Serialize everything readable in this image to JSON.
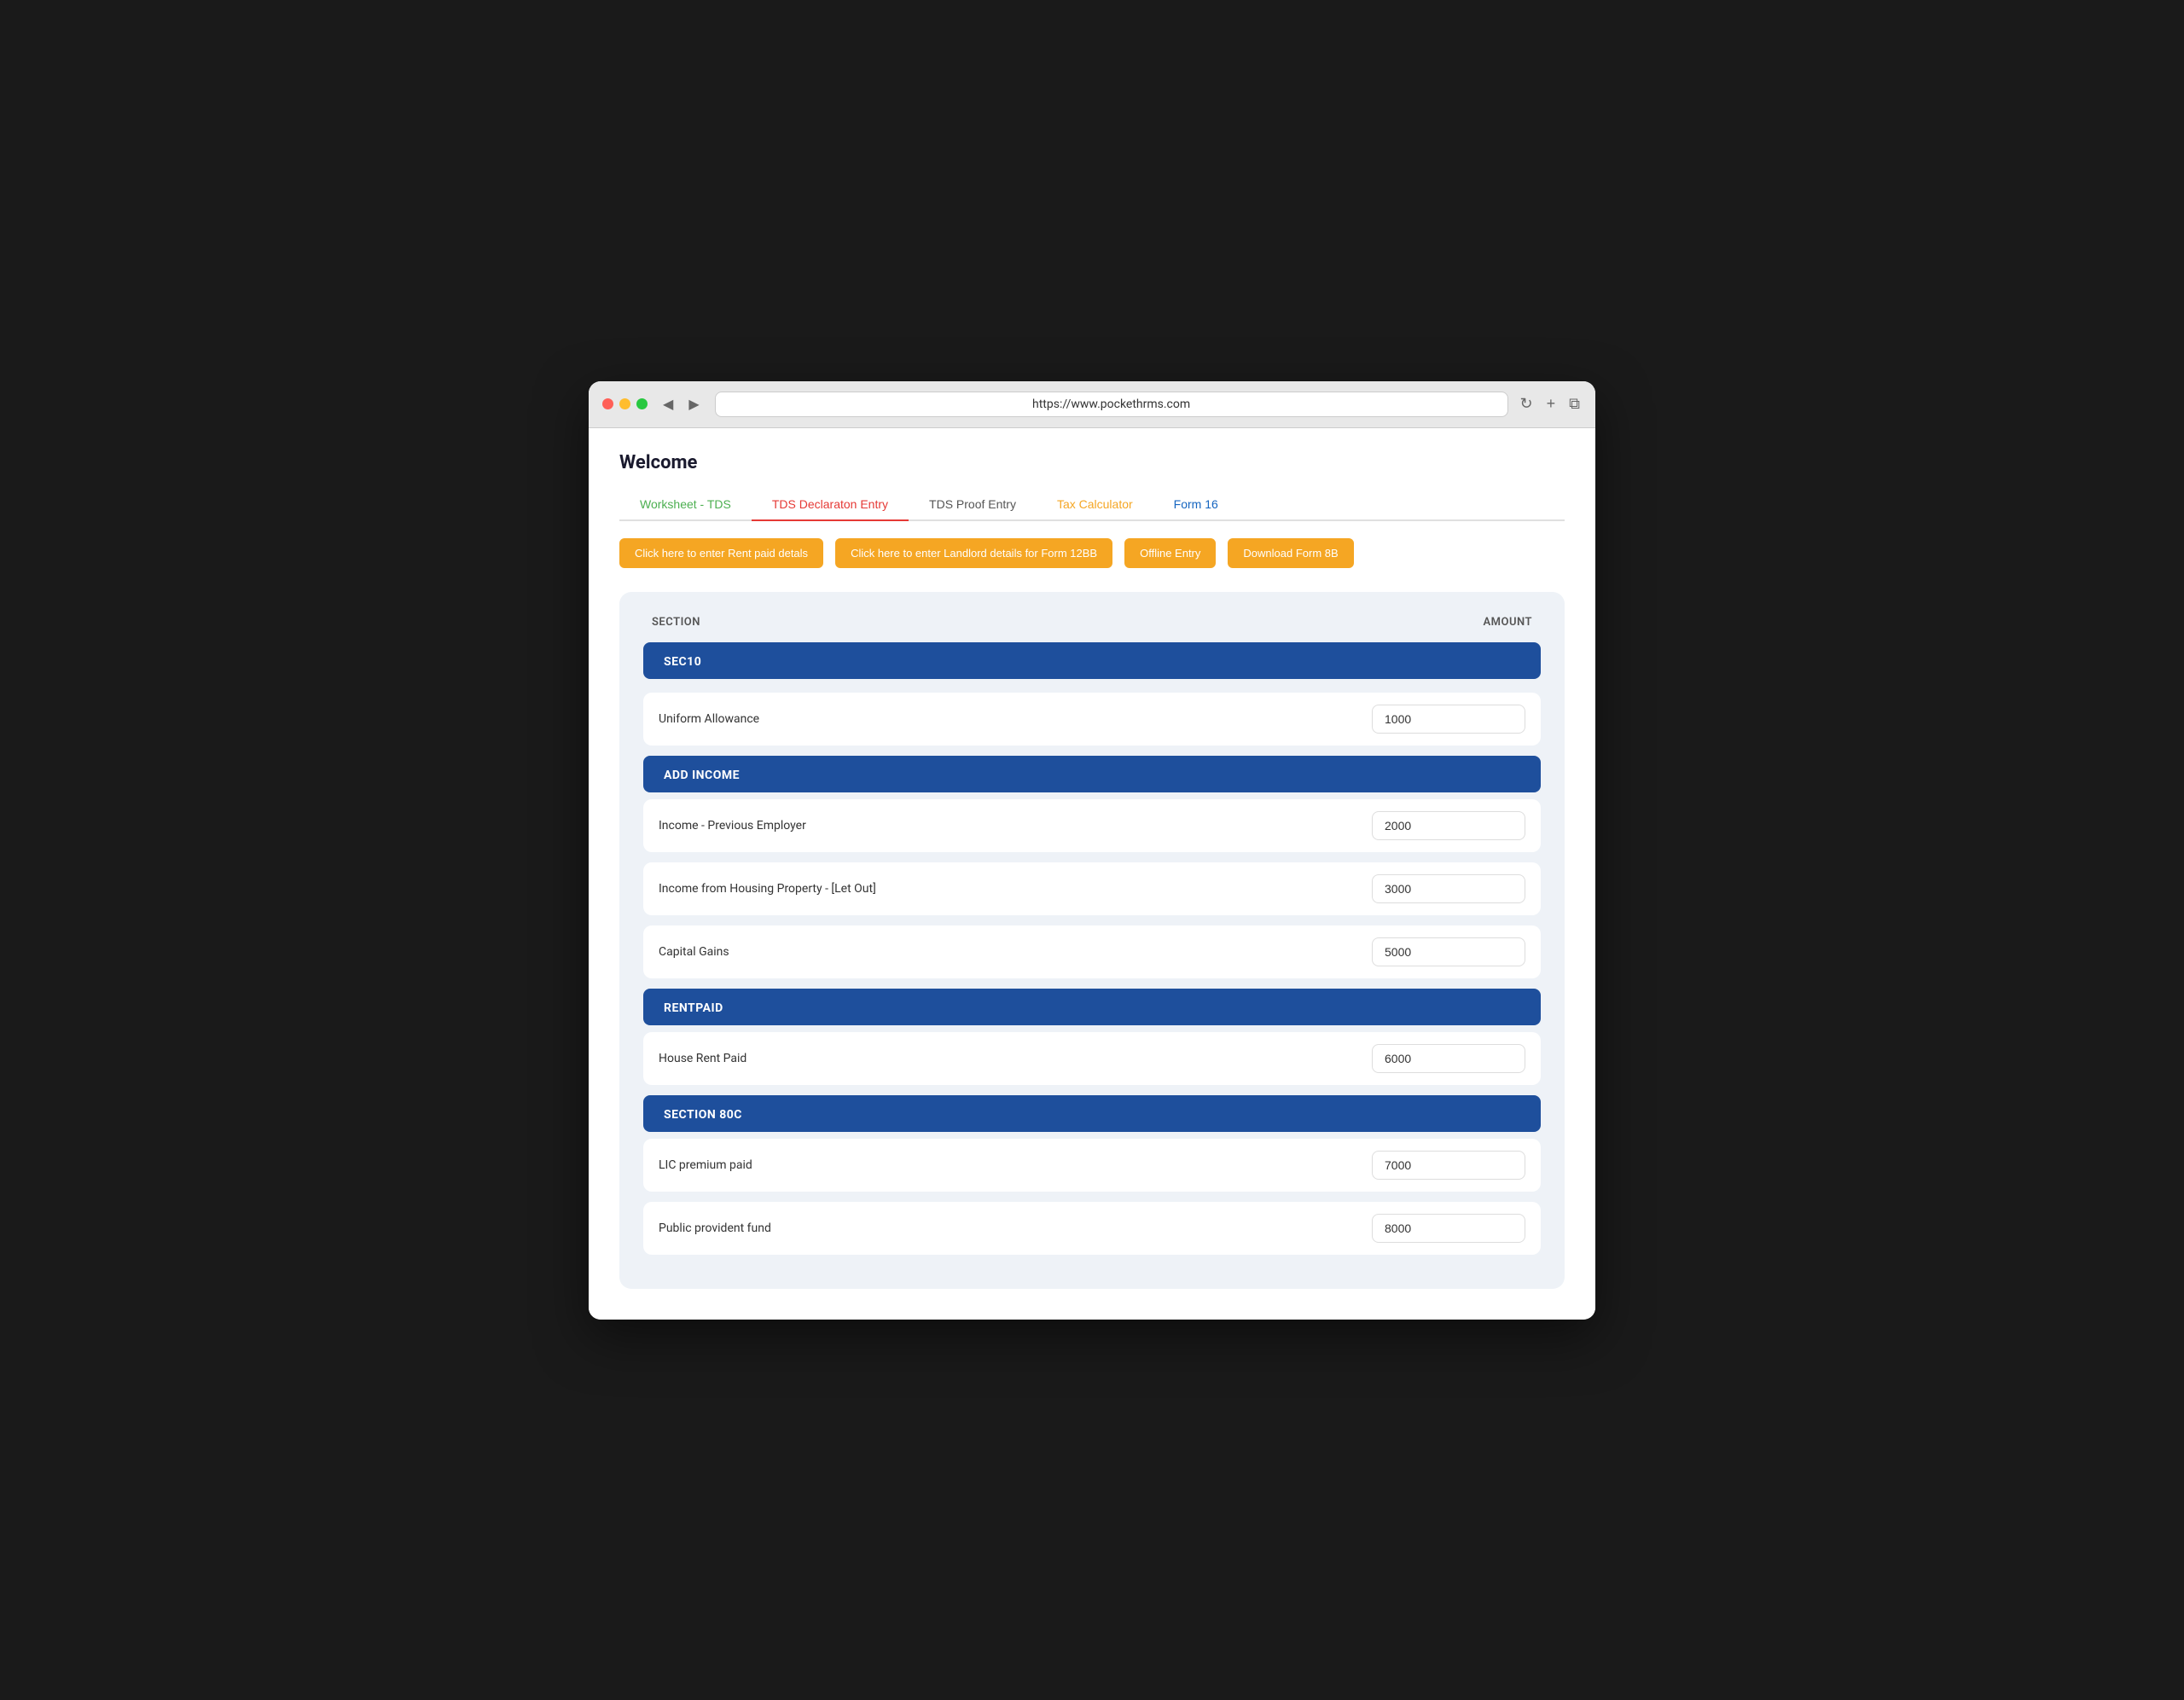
{
  "browser": {
    "url": "https://www.pockethrms.com",
    "back_icon": "◀",
    "forward_icon": "▶",
    "refresh_icon": "↻",
    "plus_icon": "+",
    "copy_icon": "⧉"
  },
  "page": {
    "title": "Welcome"
  },
  "tabs": [
    {
      "id": "worksheet",
      "label": "Worksheet - TDS",
      "class": "tab-worksheet"
    },
    {
      "id": "declaration",
      "label": "TDS Declaraton Entry",
      "class": "tab-declaration"
    },
    {
      "id": "proof",
      "label": "TDS Proof Entry",
      "class": "tab-proof"
    },
    {
      "id": "calculator",
      "label": "Tax Calculator",
      "class": "tab-calculator"
    },
    {
      "id": "form16",
      "label": "Form 16",
      "class": "tab-form16"
    }
  ],
  "action_buttons": [
    {
      "id": "rent-details",
      "label": "Click here to enter Rent paid detals"
    },
    {
      "id": "landlord-details",
      "label": "Click here to enter Landlord details for Form 12BB"
    },
    {
      "id": "offline-entry",
      "label": "Offline Entry"
    },
    {
      "id": "download-form",
      "label": "Download Form 8B"
    }
  ],
  "table": {
    "col_section": "SECTION",
    "col_amount": "AMOUNT"
  },
  "sections": [
    {
      "id": "sec10",
      "title": "SEC10",
      "fields": [
        {
          "id": "uniform-allowance",
          "label": "Uniform Allowance",
          "value": "1000"
        }
      ]
    },
    {
      "id": "add-income",
      "title": "ADD INCOME",
      "fields": [
        {
          "id": "income-prev-employer",
          "label": "Income - Previous Employer",
          "value": "2000"
        },
        {
          "id": "income-housing",
          "label": "Income from Housing Property - [Let Out]",
          "value": "3000"
        },
        {
          "id": "capital-gains",
          "label": "Capital Gains",
          "value": "5000"
        }
      ]
    },
    {
      "id": "rentpaid",
      "title": "RENTPAID",
      "fields": [
        {
          "id": "house-rent",
          "label": "House Rent Paid",
          "value": "6000"
        }
      ]
    },
    {
      "id": "section80c",
      "title": "SECTION 80C",
      "fields": [
        {
          "id": "lic-premium",
          "label": "LIC premium paid",
          "value": "7000"
        },
        {
          "id": "ppf",
          "label": "Public provident fund",
          "value": "8000"
        }
      ]
    }
  ]
}
